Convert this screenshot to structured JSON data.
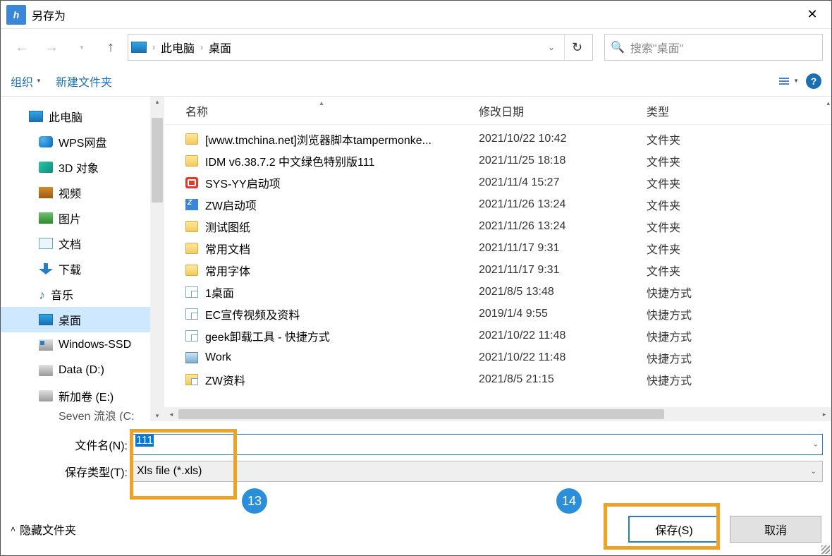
{
  "title": "另存为",
  "breadcrumb": {
    "root": "此电脑",
    "current": "桌面"
  },
  "search_placeholder": "搜索\"桌面\"",
  "toolbar": {
    "organize": "组织",
    "newfolder": "新建文件夹"
  },
  "columns": {
    "name": "名称",
    "modified": "修改日期",
    "type": "类型"
  },
  "tree": [
    {
      "label": "此电脑",
      "ico": "ico-pc",
      "lvl": 1
    },
    {
      "label": "WPS网盘",
      "ico": "ico-wps",
      "lvl": 2
    },
    {
      "label": "3D 对象",
      "ico": "ico-3d",
      "lvl": 2
    },
    {
      "label": "视频",
      "ico": "ico-vid",
      "lvl": 2
    },
    {
      "label": "图片",
      "ico": "ico-img",
      "lvl": 2
    },
    {
      "label": "文档",
      "ico": "ico-doc",
      "lvl": 2
    },
    {
      "label": "下载",
      "ico": "ico-dl",
      "lvl": 2
    },
    {
      "label": "音乐",
      "ico": "ico-mus",
      "lvl": 2,
      "glyph": "♪"
    },
    {
      "label": "桌面",
      "ico": "ico-desk",
      "lvl": 2,
      "sel": true
    },
    {
      "label": "Windows-SSD",
      "ico": "ico-win",
      "lvl": 2
    },
    {
      "label": "Data (D:)",
      "ico": "ico-drv",
      "lvl": 2
    },
    {
      "label": "新加卷 (E:)",
      "ico": "ico-drv",
      "lvl": 2
    }
  ],
  "tree_cut": "Seven 流浪 (C:",
  "files": [
    {
      "name": "[www.tmchina.net]浏览器脚本tampermonke...",
      "date": "2021/10/22 10:42",
      "type": "文件夹",
      "ico": "folder"
    },
    {
      "name": "IDM v6.38.7.2  中文绿色特别版111",
      "date": "2021/11/25 18:18",
      "type": "文件夹",
      "ico": "folder"
    },
    {
      "name": "SYS-YY启动项",
      "date": "2021/11/4 15:27",
      "type": "文件夹",
      "ico": "red"
    },
    {
      "name": "ZW启动项",
      "date": "2021/11/26 13:24",
      "type": "文件夹",
      "ico": "zw"
    },
    {
      "name": "测试图纸",
      "date": "2021/11/26 13:24",
      "type": "文件夹",
      "ico": "folder"
    },
    {
      "name": "常用文档",
      "date": "2021/11/17 9:31",
      "type": "文件夹",
      "ico": "folder"
    },
    {
      "name": "常用字体",
      "date": "2021/11/17 9:31",
      "type": "文件夹",
      "ico": "folder"
    },
    {
      "name": "1桌面",
      "date": "2021/8/5 13:48",
      "type": "快捷方式",
      "ico": "short"
    },
    {
      "name": "EC宣传视频及资料",
      "date": "2019/1/4 9:55",
      "type": "快捷方式",
      "ico": "short"
    },
    {
      "name": "geek卸载工具 - 快捷方式",
      "date": "2021/10/22 11:48",
      "type": "快捷方式",
      "ico": "short"
    },
    {
      "name": "Work",
      "date": "2021/10/22 11:48",
      "type": "快捷方式",
      "ico": "work"
    },
    {
      "name": "ZW资料",
      "date": "2021/8/5 21:15",
      "type": "快捷方式",
      "ico": "short2"
    }
  ],
  "filename_label": "文件名(N):",
  "filetype_label": "保存类型(T):",
  "filename_value": "111",
  "filetype_value": "Xls file (*.xls)",
  "hide_folders": "隐藏文件夹",
  "save": "保存(S)",
  "cancel": "取消",
  "badges": {
    "b13": "13",
    "b14": "14"
  }
}
